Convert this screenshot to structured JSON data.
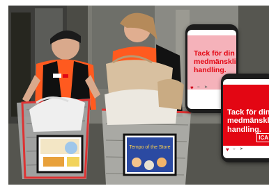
{
  "colors": {
    "ica_red": "#e30613",
    "pink_post": "#f5b2ba",
    "vest_orange": "#ff5a1f"
  },
  "phone_small": {
    "post_text": "Tack för din medmänskliga handling.",
    "icons": [
      "heart-icon",
      "comment-icon",
      "send-icon"
    ]
  },
  "phone_large": {
    "post_text": "Tack för din medmänskliga handling.",
    "brand": "ICA",
    "icons": [
      "heart-icon",
      "comment-icon",
      "send-icon"
    ]
  },
  "cart_sign_right": {
    "headline": "Tempo of the Store"
  }
}
